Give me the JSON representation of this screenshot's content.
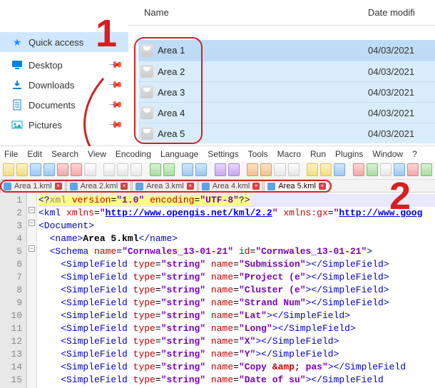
{
  "explorer": {
    "columns": {
      "name": "Name",
      "date": "Date modifi"
    },
    "sidebar": {
      "qa": "Quick access",
      "items": [
        {
          "label": "Desktop"
        },
        {
          "label": "Downloads"
        },
        {
          "label": "Documents"
        },
        {
          "label": "Pictures"
        }
      ]
    },
    "files": [
      {
        "name": "Area 1",
        "date": "04/03/2021"
      },
      {
        "name": "Area 2",
        "date": "04/03/2021"
      },
      {
        "name": "Area 3",
        "date": "04/03/2021"
      },
      {
        "name": "Area 4",
        "date": "04/03/2021"
      },
      {
        "name": "Area 5",
        "date": "04/03/2021"
      }
    ]
  },
  "annotations": {
    "one": "1",
    "two": "2"
  },
  "npp": {
    "menu": [
      "File",
      "Edit",
      "Search",
      "View",
      "Encoding",
      "Language",
      "Settings",
      "Tools",
      "Macro",
      "Run",
      "Plugins",
      "Window",
      "?"
    ],
    "tabs": [
      {
        "label": "Area 1.kml"
      },
      {
        "label": "Area 2.kml"
      },
      {
        "label": "Area 3.kml"
      },
      {
        "label": "Area 4.kml"
      },
      {
        "label": "Area 5.kml"
      }
    ],
    "active_tab": 4,
    "code": {
      "doc_name": "Area 5.kml",
      "schema_name": "Cornwales_13-01-21",
      "schema_id": "Cornwales_13-01-21",
      "kml_ns": "http://www.opengis.net/kml/2.2",
      "gx_ns": "http://www.goog",
      "fields": [
        "Submission",
        "Project (e",
        "Cluster (e",
        "Strand Num",
        "Lat",
        "Long",
        "X",
        "Y",
        "Copy &amp; pas",
        "Date of su"
      ]
    }
  }
}
